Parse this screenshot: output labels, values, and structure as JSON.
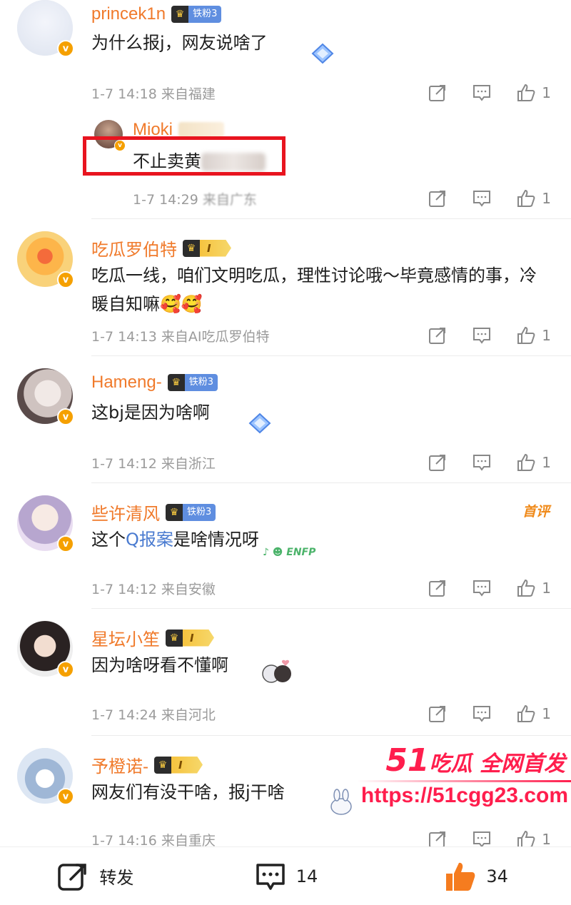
{
  "comments": [
    {
      "name": "princek1n",
      "badge_type": "fan",
      "badge": "铁粉3",
      "text": "为什么报j，网友说啥了",
      "time": "1-7 14:18",
      "location": "来自福建",
      "likes": "1"
    },
    {
      "name": "吃瓜罗伯特",
      "badge_type": "level",
      "badge": "I",
      "text": "吃瓜一线，咱们文明吃瓜，理性讨论哦～毕竟感情的事，冷暖自知嘛🥰🥰",
      "time": "1-7 14:13",
      "location": "来自AI吃瓜罗伯特",
      "likes": "1"
    },
    {
      "name": "Hameng-",
      "badge_type": "fan",
      "badge": "铁粉3",
      "text": "这bj是因为啥啊",
      "time": "1-7 14:12",
      "location": "来自浙江",
      "likes": "1"
    },
    {
      "name": "些许清风",
      "badge_type": "fan",
      "badge": "铁粉3",
      "text_pre": "这个",
      "text_link": "Q报案",
      "text_post": "是啥情况呀",
      "first_tag": "首评",
      "time": "1-7 14:12",
      "location": "来自安徽",
      "likes": "1"
    },
    {
      "name": "星坛小笙",
      "badge_type": "level",
      "badge": "I",
      "text": "因为啥呀看不懂啊",
      "time": "1-7 14:24",
      "location": "来自河北",
      "likes": "1"
    },
    {
      "name": "予橙诺-",
      "badge_type": "level",
      "badge": "I",
      "text": "网友们有没干啥，报j干啥",
      "time": "1-7 14:16",
      "location": "来自重庆",
      "likes": "1"
    }
  ],
  "reply": {
    "name": "Mioki",
    "text": "不止卖黄",
    "time": "1-7 14:29",
    "location": "来自广东",
    "likes": "1"
  },
  "watermark": {
    "num": "51",
    "line1": "吃瓜 全网首发",
    "url": "https://51cgg23.com"
  },
  "bottom": {
    "repost": "转发",
    "comments": "14",
    "likes": "34"
  },
  "colors": {
    "username": "#f07a2b",
    "accent_red": "#e8141f",
    "link": "#4a7bd0",
    "like_orange": "#f57c1f"
  }
}
